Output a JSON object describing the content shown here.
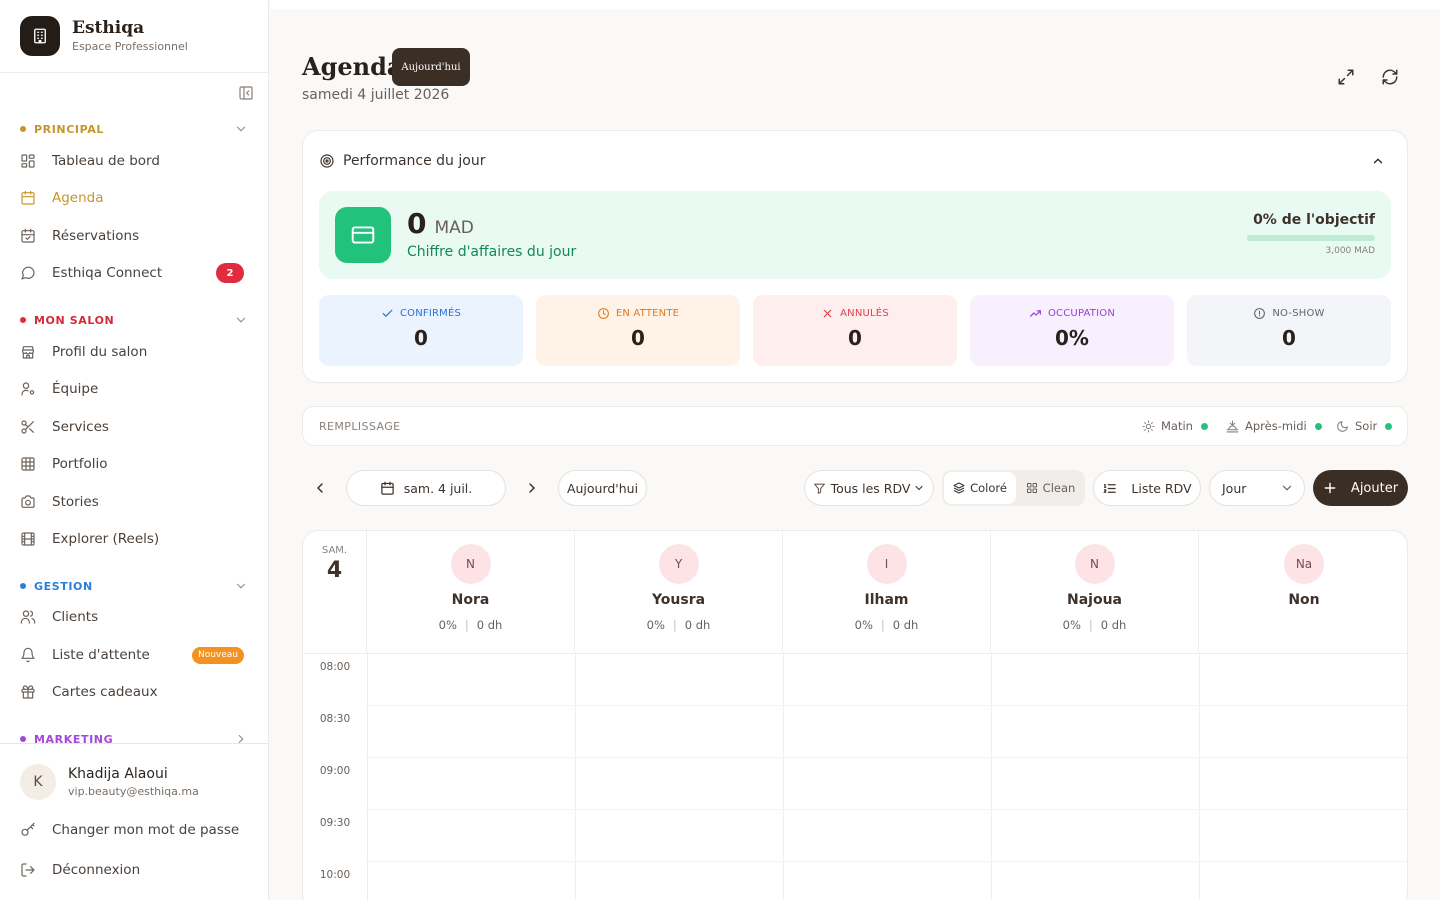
{
  "brand": {
    "name": "Esthiqa",
    "subtitle": "Espace Professionnel"
  },
  "sidebar": {
    "sections": [
      {
        "title": "PRINCIPAL",
        "color": "#c8952a"
      },
      {
        "title": "MON SALON",
        "color": "#e02c3c"
      },
      {
        "title": "GESTION",
        "color": "#2b7fd9"
      },
      {
        "title": "MARKETING",
        "color": "#a24ad6"
      }
    ],
    "items": [
      {
        "label": "Tableau de bord"
      },
      {
        "label": "Agenda"
      },
      {
        "label": "Réservations"
      },
      {
        "label": "Esthiqa Connect",
        "badge": "2"
      },
      {
        "label": "Profil du salon"
      },
      {
        "label": "Équipe"
      },
      {
        "label": "Services"
      },
      {
        "label": "Portfolio"
      },
      {
        "label": "Stories"
      },
      {
        "label": "Explorer (Reels)"
      },
      {
        "label": "Clients"
      },
      {
        "label": "Liste d'attente",
        "badge": "Nouveau"
      },
      {
        "label": "Cartes cadeaux"
      }
    ]
  },
  "user": {
    "initial": "K",
    "name": "Khadija Alaoui",
    "email": "vip.beauty@esthiqa.ma"
  },
  "footer": {
    "change_password": "Changer mon mot de passe",
    "logout": "Déconnexion"
  },
  "header": {
    "title": "Agenda",
    "today_chip": "Aujourd'hui",
    "date": "samedi 4 juillet 2026"
  },
  "performance": {
    "title": "Performance du jour",
    "revenue": {
      "value": "0",
      "currency": "MAD",
      "label": "Chiffre d'affaires du jour",
      "objective_text": "0% de l'objectif",
      "objective_progress": 0,
      "objective_target": "3,000 MAD"
    },
    "stats": [
      {
        "label": "CONFIRMÉS",
        "value": "0",
        "color": "#2b6fd9",
        "bg": "#ebf3ff"
      },
      {
        "label": "EN ATTENTE",
        "value": "0",
        "color": "#e0781e",
        "bg": "#fff3e8"
      },
      {
        "label": "ANNULÉS",
        "value": "0",
        "color": "#e0404a",
        "bg": "#ffeeee"
      },
      {
        "label": "OCCUPATION",
        "value": "0%",
        "color": "#9b3fd6",
        "bg": "#f8efff"
      },
      {
        "label": "NO-SHOW",
        "value": "0",
        "color": "#5a6573",
        "bg": "#f3f5f8"
      }
    ]
  },
  "filling": {
    "label": "REMPLISSAGE",
    "slots": [
      {
        "label": "Matin"
      },
      {
        "label": "Après-midi"
      },
      {
        "label": "Soir"
      }
    ]
  },
  "toolbar": {
    "date": "sam. 4 juil.",
    "today": "Aujourd'hui",
    "filter": "Tous les RDV",
    "mode_colored": "Coloré",
    "mode_clean": "Clean",
    "list": "Liste RDV",
    "view": "Jour",
    "add": "Ajouter"
  },
  "calendar": {
    "day_label": "SAM.",
    "day_number": "4",
    "staff": [
      {
        "initial": "N",
        "name": "Nora",
        "occupation": "0%",
        "revenue": "0 dh"
      },
      {
        "initial": "Y",
        "name": "Yousra",
        "occupation": "0%",
        "revenue": "0 dh"
      },
      {
        "initial": "I",
        "name": "Ilham",
        "occupation": "0%",
        "revenue": "0 dh"
      },
      {
        "initial": "N",
        "name": "Najoua",
        "occupation": "0%",
        "revenue": "0 dh"
      },
      {
        "initial": "Na",
        "name": "Non"
      }
    ],
    "times": [
      "08:00",
      "08:30",
      "09:00",
      "09:30",
      "10:00"
    ]
  }
}
